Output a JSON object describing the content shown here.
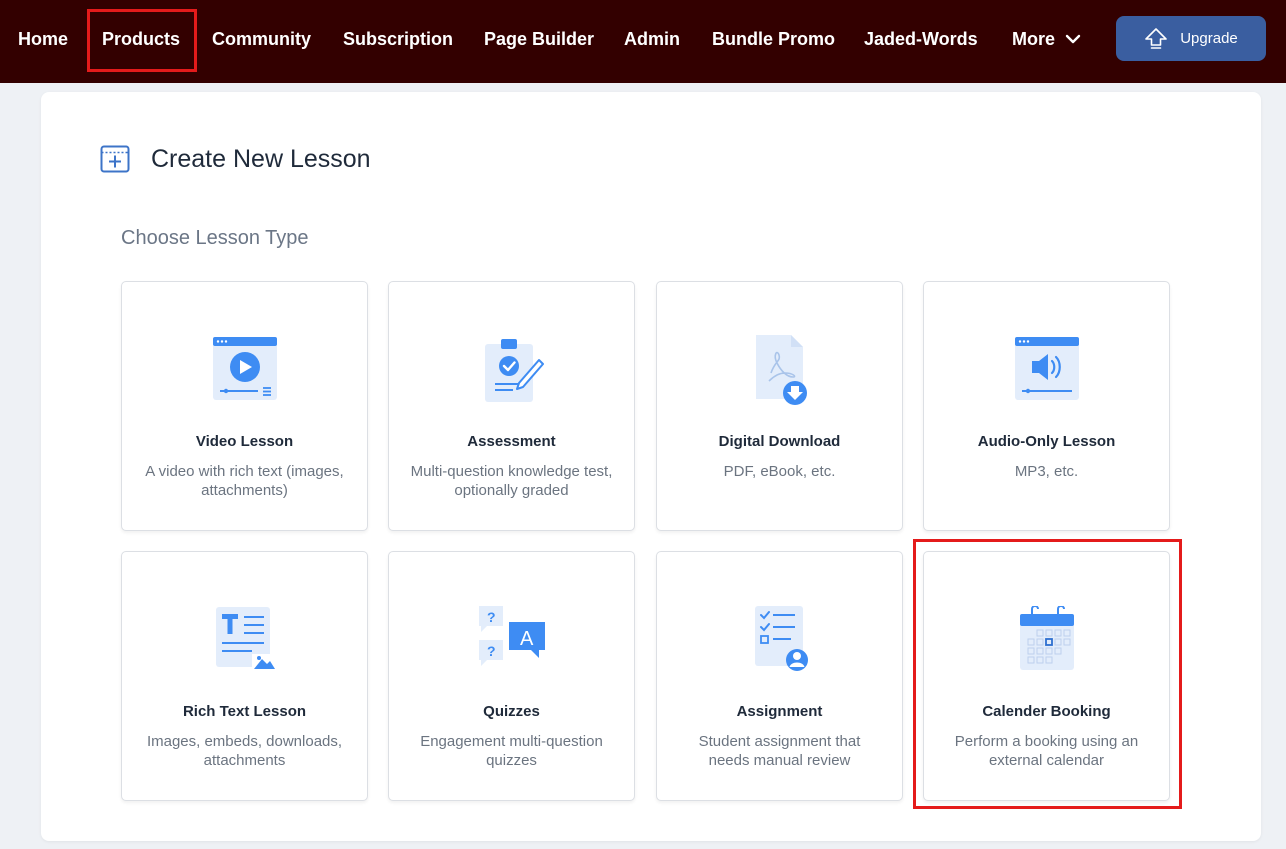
{
  "nav": {
    "items": [
      {
        "label": "Home"
      },
      {
        "label": "Products"
      },
      {
        "label": "Community"
      },
      {
        "label": "Subscription"
      },
      {
        "label": "Page Builder"
      },
      {
        "label": "Admin"
      },
      {
        "label": "Bundle Promo"
      },
      {
        "label": "Jaded-Words"
      },
      {
        "label": "More"
      }
    ],
    "upgrade_label": "Upgrade",
    "background_color": "#330000",
    "upgrade_color": "#3a5ea0",
    "highlight_color": "#e41b1b"
  },
  "page": {
    "title": "Create New Lesson",
    "section_label": "Choose Lesson Type"
  },
  "lesson_types": [
    {
      "title": "Video Lesson",
      "description": "A video with rich text (images, attachments)",
      "icon": "video-icon"
    },
    {
      "title": "Assessment",
      "description": "Multi-question knowledge test, optionally graded",
      "icon": "assessment-icon"
    },
    {
      "title": "Digital Download",
      "description": "PDF, eBook, etc.",
      "icon": "download-icon"
    },
    {
      "title": "Audio-Only Lesson",
      "description": "MP3, etc.",
      "icon": "audio-icon"
    },
    {
      "title": "Rich Text Lesson",
      "description": "Images, embeds, downloads, attachments",
      "icon": "rich-text-icon"
    },
    {
      "title": "Quizzes",
      "description": "Engagement multi-question quizzes",
      "icon": "quiz-icon"
    },
    {
      "title": "Assignment",
      "description": "Student assignment that needs manual review",
      "icon": "assignment-icon"
    },
    {
      "title": "Calender Booking",
      "description": "Perform a booking using an external calendar",
      "icon": "calendar-icon"
    }
  ]
}
